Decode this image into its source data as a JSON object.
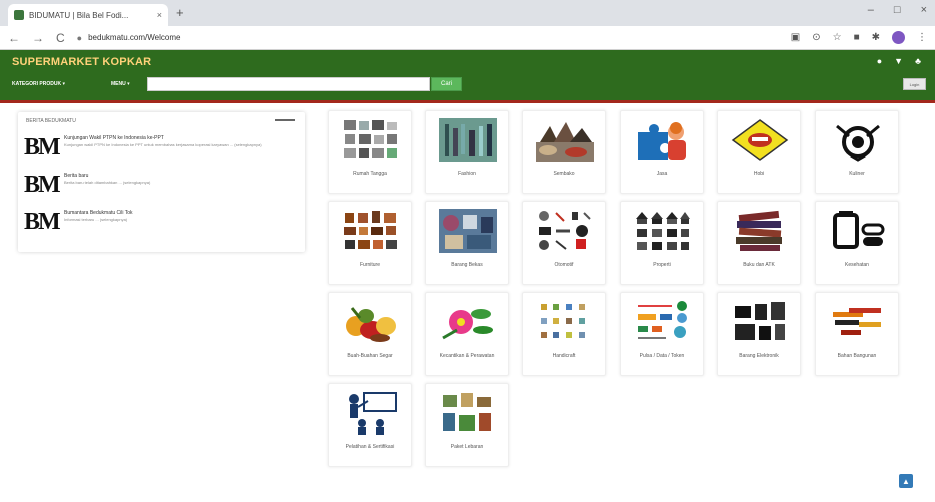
{
  "browser": {
    "tab_title": "BIDUMATU | Bila Bel Fodi...",
    "tab_close": "×",
    "new_tab": "+",
    "min": "–",
    "max": "□",
    "close": "×",
    "back": "←",
    "forward": "→",
    "reload": "C",
    "url": "bedukmatu.com/Welcome"
  },
  "header": {
    "brand": "SUPERMARKET KOPKAR",
    "category_menu": "KATEGORI PRODUK ▾",
    "menu2": "MENU ▾",
    "search_value": "",
    "search_button": "Cari",
    "login_button": "Login"
  },
  "news_panel": {
    "heading": "BERITA BEDUKMATU",
    "items": [
      {
        "logo": "BM",
        "title": "Kunjungan Wakil PTPN ke Indonesia ke-PPT",
        "desc": "Kunjungan wakil PTPN ke Indonesia ke PPT untuk membahas kerjasama koperasi karyawan ... (selengkapnya)"
      },
      {
        "logo": "BM",
        "title": "Berita baru",
        "desc": "Berita baru telah ditambahkan ... (selengkapnya)"
      },
      {
        "logo": "BM",
        "title": "Bumantara Bedukmatu Cili Tok",
        "desc": "Informasi terbaru ... (selengkapnya)"
      }
    ]
  },
  "categories": [
    {
      "label": "Rumah Tangga",
      "icon": "household-icon"
    },
    {
      "label": "Fashion",
      "icon": "fashion-icon"
    },
    {
      "label": "Sembako",
      "icon": "groceries-icon"
    },
    {
      "label": "Jasa",
      "icon": "services-icon"
    },
    {
      "label": "Hobi",
      "icon": "hobby-icon"
    },
    {
      "label": "Kuliner",
      "icon": "culinary-icon"
    },
    {
      "label": "Furniture",
      "icon": "furniture-icon"
    },
    {
      "label": "Barang Bekas",
      "icon": "used-goods-icon"
    },
    {
      "label": "Otomotif",
      "icon": "automotive-icon"
    },
    {
      "label": "Properti",
      "icon": "property-icon"
    },
    {
      "label": "Buku dan ATK",
      "icon": "books-icon"
    },
    {
      "label": "Kesehatan",
      "icon": "health-icon"
    },
    {
      "label": "Buah-Buahan Segar",
      "icon": "fruit-icon"
    },
    {
      "label": "Kecantikan & Perawatan",
      "icon": "beauty-icon"
    },
    {
      "label": "Handicraft",
      "icon": "handicraft-icon"
    },
    {
      "label": "Pulsa / Data / Token",
      "icon": "phone-credit-icon"
    },
    {
      "label": "Barang Elektronik",
      "icon": "electronics-icon"
    },
    {
      "label": "Bahan Bangunan",
      "icon": "building-materials-icon"
    },
    {
      "label": "Pelatihan & Sertifikasi",
      "icon": "training-icon"
    },
    {
      "label": "Paket Lebaran",
      "icon": "lebaran-package-icon"
    }
  ],
  "colors": {
    "header_bg": "#2e6b1e",
    "accent_line": "#a3281c",
    "search_button": "#5cb85c",
    "brand_text": "#ffd27a"
  }
}
